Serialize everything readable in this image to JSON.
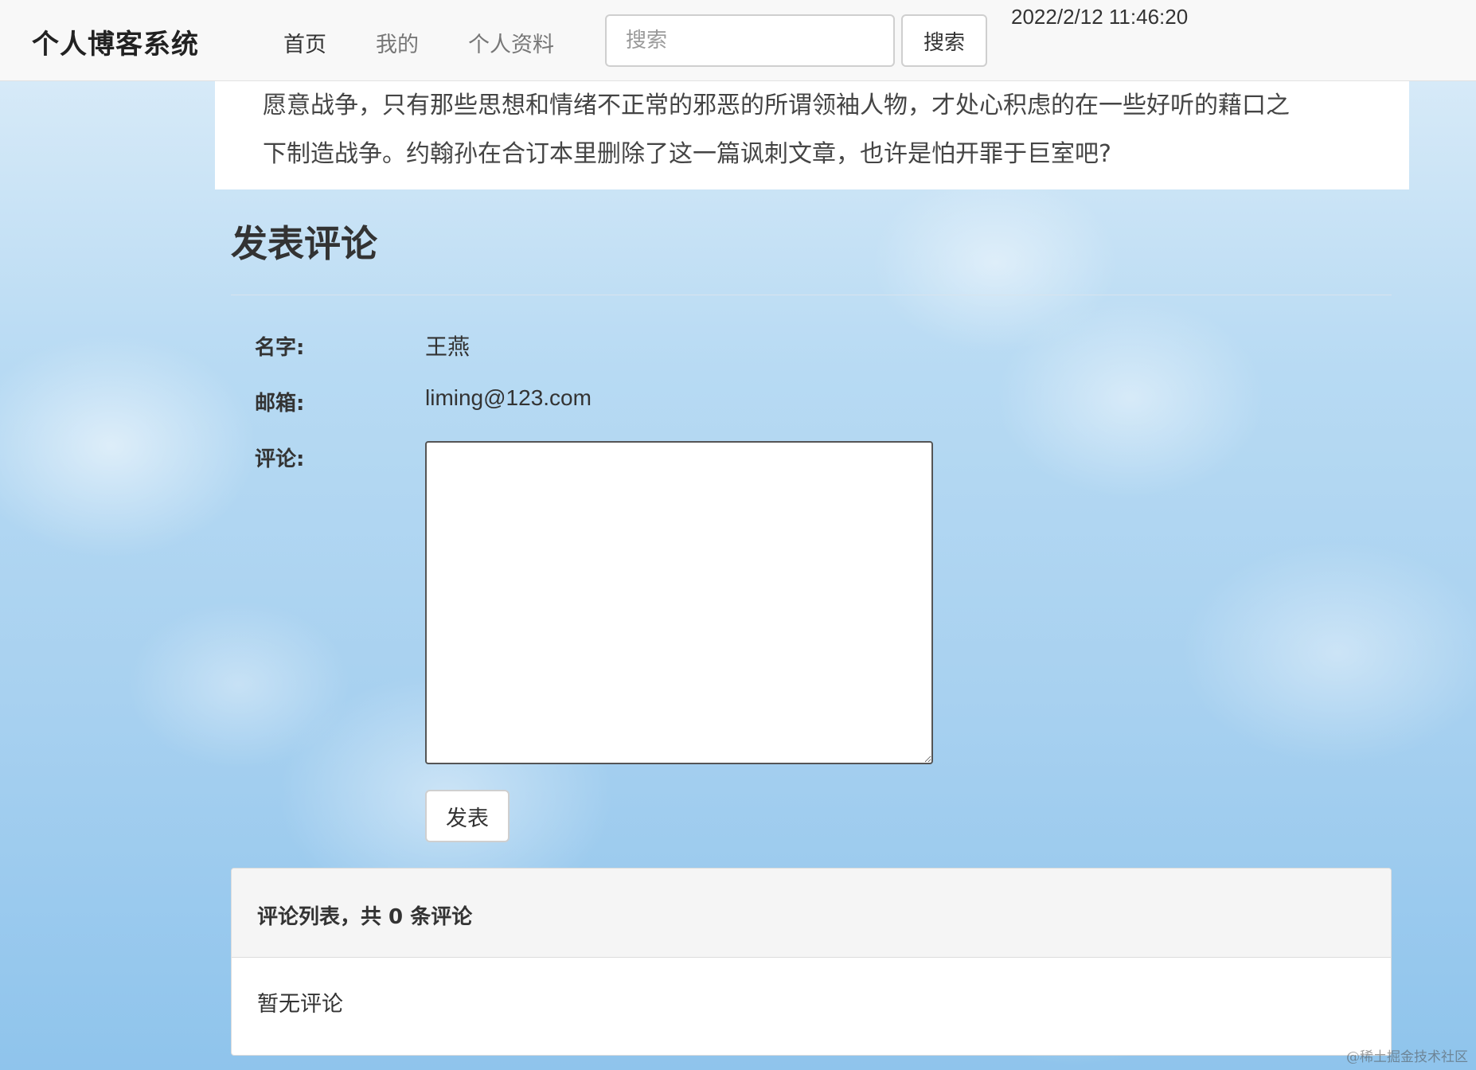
{
  "header": {
    "brand": "个人博客系统",
    "nav": [
      {
        "label": "首页",
        "active": true
      },
      {
        "label": "我的",
        "active": false
      },
      {
        "label": "个人资料",
        "active": false
      }
    ],
    "search_placeholder": "搜索",
    "search_button": "搜索",
    "datetime": "2022/2/12 11:46:20"
  },
  "article": {
    "lines": [
      "愿意战争，只有那些思想和情绪不正常的邪恶的所谓领袖人物，才处心积虑的在一些好听的藉口之",
      "下制造战争。约翰孙在合订本里删除了这一篇讽刺文章，也许是怕开罪于巨室吧?"
    ]
  },
  "comment_form": {
    "heading": "发表评论",
    "name_label": "名字:",
    "name_value": "王燕",
    "email_label": "邮箱:",
    "email_value": "liming@123.com",
    "comment_label": "评论:",
    "comment_value": "",
    "submit": "发表"
  },
  "comment_list": {
    "heading": "评论列表，共 0 条评论",
    "empty": "暂无评论"
  },
  "watermark": "@稀土掘金技术社区"
}
